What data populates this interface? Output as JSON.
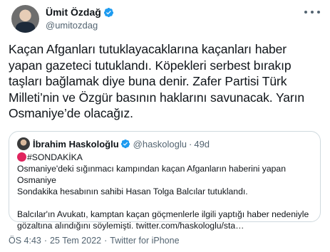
{
  "author": {
    "display_name": "Ümit Özdağ",
    "handle": "@umitozdag"
  },
  "tweet": {
    "text": "Kaçan Afganları tutuklayacaklarına kaçanları haber\nyapan gazeteci tutuklandı. Köpekleri serbest bırakıp\ntaşları bağlamak diye buna denir. Zafer Partisi Türk\nMilleti’nin ve Özgür basının haklarını savunacak. Yarın\nOsmaniye’de olacağız."
  },
  "quoted": {
    "display_name": "İbrahim Haskoloğlu",
    "handle": "@haskologlu",
    "separator": "·",
    "time": "49d",
    "hashtag": "#SONDAKİKA",
    "text": "Osmaniye'deki sığınmacı kampından kaçan Afganların haberini yapan Osmaniye\nSondakika hesabının sahibi Hasan Tolga Balcılar tutuklandı.\n\nBalcılar'ın Avukatı, kamptan kaçan göçmenlerle ilgili yaptığı haber nedeniyle\ngözaltına alındığını söylemişti. twitter.com/haskologlu/sta…"
  },
  "meta": {
    "time": "ÖS 4:43",
    "separator1": "·",
    "date": "25 Tem 2022",
    "separator2": "·",
    "source": "Twitter for iPhone"
  },
  "colors": {
    "verified": "#1d9bf0",
    "secondary_text": "#536471",
    "border": "#cfd9de",
    "red_circle": "#e0245e"
  },
  "icons": [
    "verified-badge-icon",
    "more-options-icon",
    "red-circle-emoji-icon"
  ]
}
